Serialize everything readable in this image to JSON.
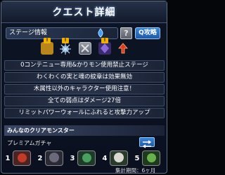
{
  "header": {
    "title": "クエスト詳細"
  },
  "stage": {
    "label": "ステージ情報",
    "help_label": "?",
    "guide_label": "Q攻略"
  },
  "gimmicks": [
    {
      "icon": "gimmick-badge-icon",
      "badge": "!"
    },
    {
      "icon": "spiked-mine-icon",
      "badge": "!"
    },
    {
      "icon": "panel-icon"
    },
    {
      "icon": "crystal-monster-icon",
      "badge": "!"
    },
    {
      "icon": "red-up-arrow-icon"
    }
  ],
  "rules": [
    "0コンテニュー専用&かりモン使用禁止ステージ",
    "わくわくの実と魂の紋章は効果無効",
    "木属性以外のキャラクター使用注意！",
    "全ての弱点はダメージ27倍",
    "リミットパワーウォールにふれると攻撃力アップ"
  ],
  "clear_monsters": {
    "header": "みんなのクリアモンスター",
    "gacha_label": "プレミアムガチャ",
    "ranks": [
      "1",
      "2",
      "3",
      "4",
      "5"
    ],
    "period": "集計期間：6ヶ月"
  },
  "colors": {
    "accent": "#2a6fc4",
    "badge": "#f0b000"
  }
}
